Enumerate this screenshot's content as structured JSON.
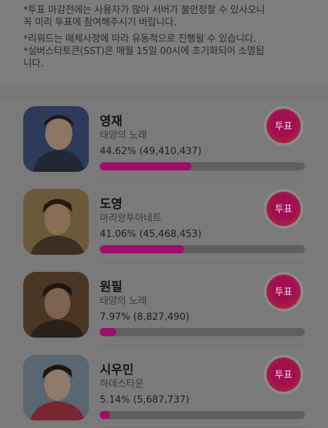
{
  "notice": {
    "lines": [
      "*투표 마감전에는 사용자가 많아 서버가 불안정할 수 있사오니",
      "꼭 미리 투표에 참여해주시기 바랍니다.",
      "*리워드는 매체사정에 따라 유동적으로 진행될 수 있습니다.",
      "*실버스타토큰(SST)은 매월 15일 00시에 초기화되어 소멸됩",
      "니다."
    ]
  },
  "candidates": [
    {
      "name": "영재",
      "song": "태양의 노래",
      "percent_text": "44.62% (49,410,437)",
      "percent": 44.62,
      "vote_label": "투표"
    },
    {
      "name": "도영",
      "song": "마리앙투아네트",
      "percent_text": "41.06% (45,468,453)",
      "percent": 41.06,
      "vote_label": "투표"
    },
    {
      "name": "원필",
      "song": "태양의 노래",
      "percent_text": "7.97% (8,827,490)",
      "percent": 7.97,
      "vote_label": "투표"
    },
    {
      "name": "시우민",
      "song": "하데스타운",
      "percent_text": "5.14% (5,687,737)",
      "percent": 5.14,
      "vote_label": "투표"
    }
  ],
  "colors": {
    "bar_fill": "#9c0e67",
    "bar_track": "#5f5f5f",
    "button": "#a40a58"
  }
}
